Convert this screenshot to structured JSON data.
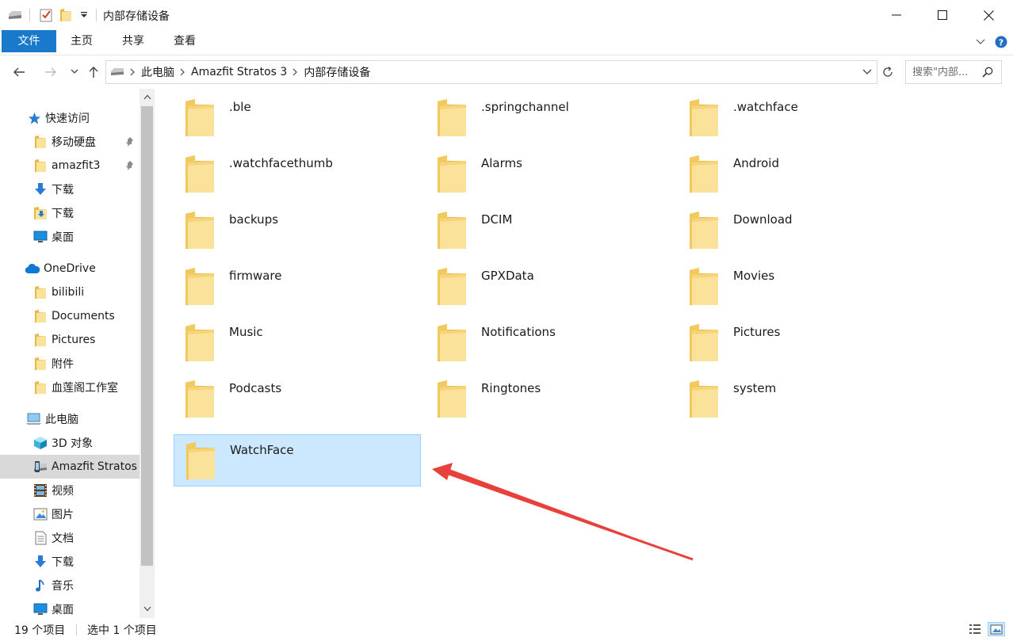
{
  "window": {
    "title": "内部存储设备"
  },
  "ribbon": {
    "tabs": [
      "文件",
      "主页",
      "共享",
      "查看"
    ]
  },
  "address": {
    "crumbs": [
      "此电脑",
      "Amazfit Stratos 3",
      "内部存储设备"
    ],
    "search_placeholder": "搜索\"内部..."
  },
  "nav": {
    "items": [
      {
        "label": "快速访问",
        "icon": "star-icon"
      },
      {
        "label": "移动硬盘",
        "icon": "folder-icon",
        "pinned": true
      },
      {
        "label": "amazfit3",
        "icon": "folder-icon",
        "pinned": true
      },
      {
        "label": "下载",
        "icon": "download-arrow-icon"
      },
      {
        "label": "下载",
        "icon": "download-folder-icon"
      },
      {
        "label": "桌面",
        "icon": "desktop-icon"
      },
      {
        "label": "OneDrive",
        "icon": "cloud-icon"
      },
      {
        "label": "bilibili",
        "icon": "folder-icon"
      },
      {
        "label": "Documents",
        "icon": "folder-icon"
      },
      {
        "label": "Pictures",
        "icon": "folder-icon"
      },
      {
        "label": "附件",
        "icon": "folder-icon"
      },
      {
        "label": "血莲阁工作室",
        "icon": "folder-icon"
      },
      {
        "label": "此电脑",
        "icon": "computer-icon"
      },
      {
        "label": "3D 对象",
        "icon": "cube-3d-icon"
      },
      {
        "label": "Amazfit Stratos",
        "icon": "device-icon",
        "selected": true
      },
      {
        "label": "视频",
        "icon": "film-icon"
      },
      {
        "label": "图片",
        "icon": "picture-icon"
      },
      {
        "label": "文档",
        "icon": "document-icon"
      },
      {
        "label": "下载",
        "icon": "download-arrow-icon"
      },
      {
        "label": "音乐",
        "icon": "music-note-icon"
      },
      {
        "label": "桌面",
        "icon": "desktop-icon"
      }
    ]
  },
  "folders": [
    ".ble",
    ".springchannel",
    ".watchface",
    ".watchfacethumb",
    "Alarms",
    "Android",
    "backups",
    "DCIM",
    "Download",
    "firmware",
    "GPXData",
    "Movies",
    "Music",
    "Notifications",
    "Pictures",
    "Podcasts",
    "Ringtones",
    "system",
    "WatchFace"
  ],
  "selected_folder": "WatchFace",
  "status": {
    "count": "19 个项目",
    "selection": "选中 1 个项目"
  },
  "colors": {
    "accent": "#1979ca",
    "selection": "#cce8ff",
    "selection_border": "#99d1ff",
    "arrow": "#e8403b",
    "folder": "#f8d775"
  }
}
